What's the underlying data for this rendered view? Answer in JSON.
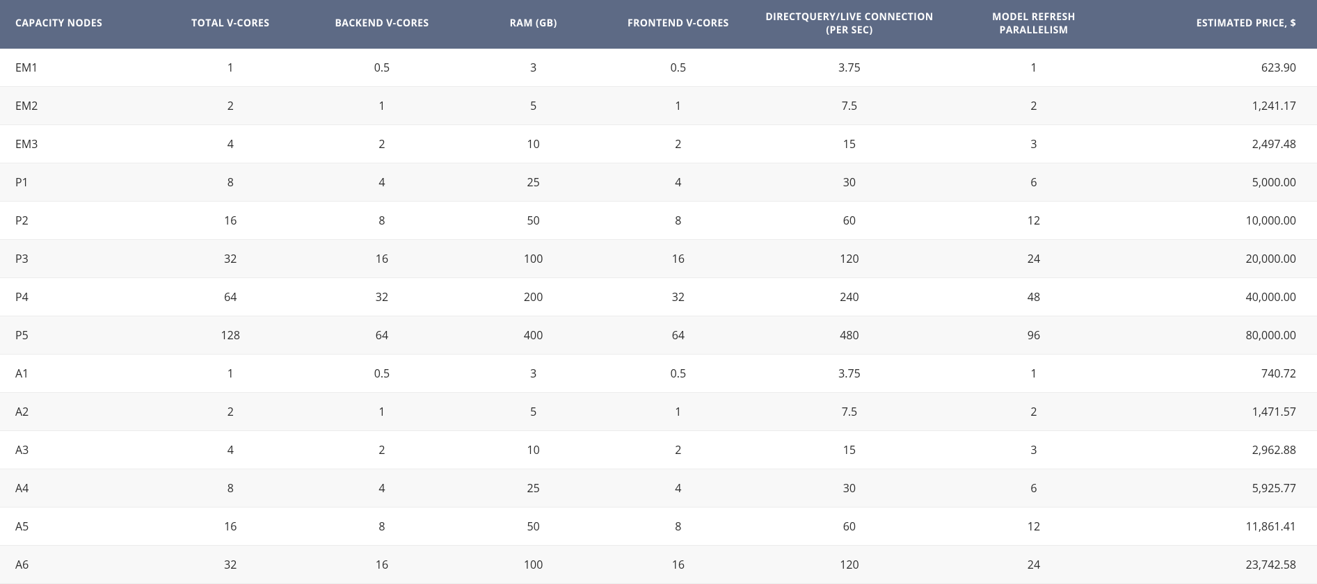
{
  "table": {
    "headers": [
      "CAPACITY NODES",
      "TOTAL V-CORES",
      "BACKEND V-CORES",
      "RAM (GB)",
      "FRONTEND V-CORES",
      "DIRECTQUERY/LIVE CONNECTION (PER SEC)",
      "MODEL REFRESH PARALLELISM",
      "ESTIMATED PRICE, $"
    ],
    "rows": [
      {
        "node": "EM1",
        "total_vcores": "1",
        "backend_vcores": "0.5",
        "ram_gb": "3",
        "frontend_vcores": "0.5",
        "dq_live_per_sec": "3.75",
        "refresh_parallelism": "1",
        "price": "623.90"
      },
      {
        "node": "EM2",
        "total_vcores": "2",
        "backend_vcores": "1",
        "ram_gb": "5",
        "frontend_vcores": "1",
        "dq_live_per_sec": "7.5",
        "refresh_parallelism": "2",
        "price": "1,241.17"
      },
      {
        "node": "EM3",
        "total_vcores": "4",
        "backend_vcores": "2",
        "ram_gb": "10",
        "frontend_vcores": "2",
        "dq_live_per_sec": "15",
        "refresh_parallelism": "3",
        "price": "2,497.48"
      },
      {
        "node": "P1",
        "total_vcores": "8",
        "backend_vcores": "4",
        "ram_gb": "25",
        "frontend_vcores": "4",
        "dq_live_per_sec": "30",
        "refresh_parallelism": "6",
        "price": "5,000.00"
      },
      {
        "node": "P2",
        "total_vcores": "16",
        "backend_vcores": "8",
        "ram_gb": "50",
        "frontend_vcores": "8",
        "dq_live_per_sec": "60",
        "refresh_parallelism": "12",
        "price": "10,000.00"
      },
      {
        "node": "P3",
        "total_vcores": "32",
        "backend_vcores": "16",
        "ram_gb": "100",
        "frontend_vcores": "16",
        "dq_live_per_sec": "120",
        "refresh_parallelism": "24",
        "price": "20,000.00"
      },
      {
        "node": "P4",
        "total_vcores": "64",
        "backend_vcores": "32",
        "ram_gb": "200",
        "frontend_vcores": "32",
        "dq_live_per_sec": "240",
        "refresh_parallelism": "48",
        "price": "40,000.00"
      },
      {
        "node": "P5",
        "total_vcores": "128",
        "backend_vcores": "64",
        "ram_gb": "400",
        "frontend_vcores": "64",
        "dq_live_per_sec": "480",
        "refresh_parallelism": "96",
        "price": "80,000.00"
      },
      {
        "node": "A1",
        "total_vcores": "1",
        "backend_vcores": "0.5",
        "ram_gb": "3",
        "frontend_vcores": "0.5",
        "dq_live_per_sec": "3.75",
        "refresh_parallelism": "1",
        "price": "740.72"
      },
      {
        "node": "A2",
        "total_vcores": "2",
        "backend_vcores": "1",
        "ram_gb": "5",
        "frontend_vcores": "1",
        "dq_live_per_sec": "7.5",
        "refresh_parallelism": "2",
        "price": "1,471.57"
      },
      {
        "node": "A3",
        "total_vcores": "4",
        "backend_vcores": "2",
        "ram_gb": "10",
        "frontend_vcores": "2",
        "dq_live_per_sec": "15",
        "refresh_parallelism": "3",
        "price": "2,962.88"
      },
      {
        "node": "A4",
        "total_vcores": "8",
        "backend_vcores": "4",
        "ram_gb": "25",
        "frontend_vcores": "4",
        "dq_live_per_sec": "30",
        "refresh_parallelism": "6",
        "price": "5,925.77"
      },
      {
        "node": "A5",
        "total_vcores": "16",
        "backend_vcores": "8",
        "ram_gb": "50",
        "frontend_vcores": "8",
        "dq_live_per_sec": "60",
        "refresh_parallelism": "12",
        "price": "11,861.41"
      },
      {
        "node": "A6",
        "total_vcores": "32",
        "backend_vcores": "16",
        "ram_gb": "100",
        "frontend_vcores": "16",
        "dq_live_per_sec": "120",
        "refresh_parallelism": "24",
        "price": "23,742.58"
      }
    ]
  }
}
